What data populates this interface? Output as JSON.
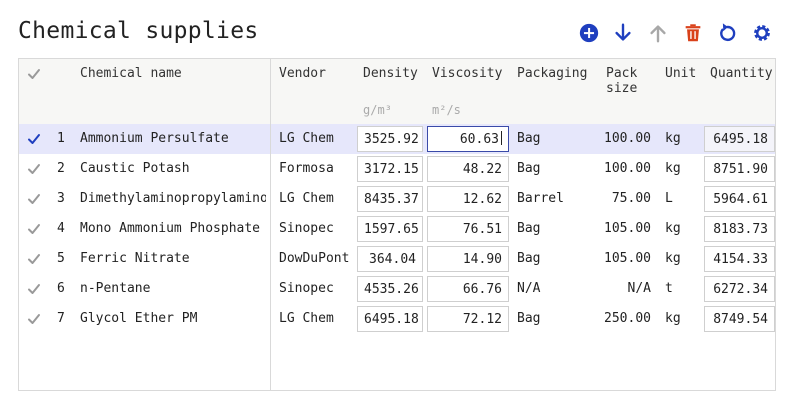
{
  "title": "Chemical supplies",
  "toolbar": {
    "icons": [
      "add-circle-icon",
      "arrow-down-icon",
      "arrow-up-icon",
      "trash-icon",
      "undo-icon",
      "gear-icon"
    ],
    "colors": {
      "primary": "#1f3fbf",
      "disabled": "#a8a8a8",
      "danger": "#d9411a"
    }
  },
  "columns": {
    "name": "Chemical name",
    "vendor": "Vendor",
    "density": "Density",
    "density_unit": "g/m³",
    "viscosity": "Viscosity",
    "viscosity_unit": "m²/s",
    "packaging": "Packaging",
    "pack_size_line1": "Pack",
    "pack_size_line2": "size",
    "unit": "Unit",
    "quantity": "Quantity"
  },
  "rows": [
    {
      "num": "1",
      "name": "Ammonium Persulfate",
      "vendor": "LG Chem",
      "density": "3525.92",
      "viscosity": "60.63",
      "packaging": "Bag",
      "pack_size": "100.00",
      "unit": "kg",
      "quantity": "6495.18"
    },
    {
      "num": "2",
      "name": "Caustic Potash",
      "vendor": "Formosa",
      "density": "3172.15",
      "viscosity": "48.22",
      "packaging": "Bag",
      "pack_size": "100.00",
      "unit": "kg",
      "quantity": "8751.90"
    },
    {
      "num": "3",
      "name": "Dimethylaminopropylamino",
      "vendor": "LG Chem",
      "density": "8435.37",
      "viscosity": "12.62",
      "packaging": "Barrel",
      "pack_size": "75.00",
      "unit": "L",
      "quantity": "5964.61"
    },
    {
      "num": "4",
      "name": "Mono Ammonium Phosphate",
      "vendor": "Sinopec",
      "density": "1597.65",
      "viscosity": "76.51",
      "packaging": "Bag",
      "pack_size": "105.00",
      "unit": "kg",
      "quantity": "8183.73"
    },
    {
      "num": "5",
      "name": "Ferric Nitrate",
      "vendor": "DowDuPont",
      "density": "364.04",
      "viscosity": "14.90",
      "packaging": "Bag",
      "pack_size": "105.00",
      "unit": "kg",
      "quantity": "4154.33"
    },
    {
      "num": "6",
      "name": "n-Pentane",
      "vendor": "Sinopec",
      "density": "4535.26",
      "viscosity": "66.76",
      "packaging": "N/A",
      "pack_size": "N/A",
      "unit": "t",
      "quantity": "6272.34"
    },
    {
      "num": "7",
      "name": "Glycol Ether PM",
      "vendor": "LG Chem",
      "density": "6495.18",
      "viscosity": "72.12",
      "packaging": "Bag",
      "pack_size": "250.00",
      "unit": "kg",
      "quantity": "8749.54"
    }
  ],
  "selected_row": 0,
  "active_cell": {
    "row": 0,
    "column": "viscosity"
  },
  "colors": {
    "selected_row_bg": "#e6e7fb",
    "check_selected": "#1f3fbf",
    "check_default": "#9a9a9a"
  }
}
